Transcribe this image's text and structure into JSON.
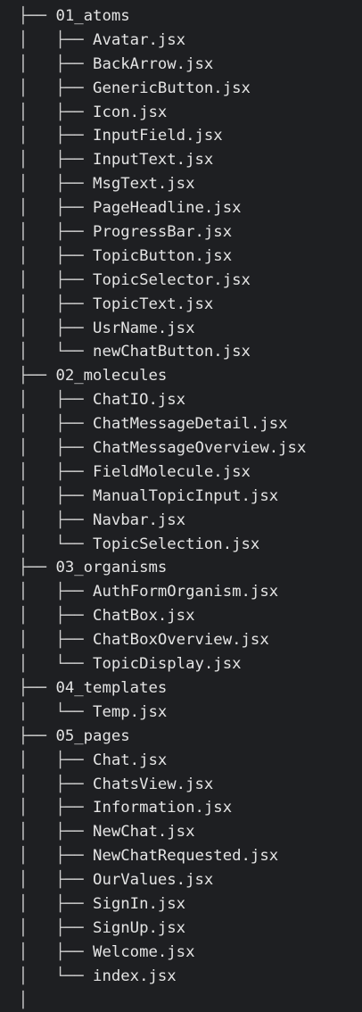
{
  "tree": {
    "rows": [
      {
        "prefix": "  ├── ",
        "name": "01_atoms",
        "type": "folder"
      },
      {
        "prefix": "  │   ├── ",
        "name": "Avatar.jsx",
        "type": "file"
      },
      {
        "prefix": "  │   ├── ",
        "name": "BackArrow.jsx",
        "type": "file"
      },
      {
        "prefix": "  │   ├── ",
        "name": "GenericButton.jsx",
        "type": "file"
      },
      {
        "prefix": "  │   ├── ",
        "name": "Icon.jsx",
        "type": "file"
      },
      {
        "prefix": "  │   ├── ",
        "name": "InputField.jsx",
        "type": "file"
      },
      {
        "prefix": "  │   ├── ",
        "name": "InputText.jsx",
        "type": "file"
      },
      {
        "prefix": "  │   ├── ",
        "name": "MsgText.jsx",
        "type": "file"
      },
      {
        "prefix": "  │   ├── ",
        "name": "PageHeadline.jsx",
        "type": "file"
      },
      {
        "prefix": "  │   ├── ",
        "name": "ProgressBar.jsx",
        "type": "file"
      },
      {
        "prefix": "  │   ├── ",
        "name": "TopicButton.jsx",
        "type": "file"
      },
      {
        "prefix": "  │   ├── ",
        "name": "TopicSelector.jsx",
        "type": "file"
      },
      {
        "prefix": "  │   ├── ",
        "name": "TopicText.jsx",
        "type": "file"
      },
      {
        "prefix": "  │   ├── ",
        "name": "UsrName.jsx",
        "type": "file"
      },
      {
        "prefix": "  │   └── ",
        "name": "newChatButton.jsx",
        "type": "file"
      },
      {
        "prefix": "  ├── ",
        "name": "02_molecules",
        "type": "folder"
      },
      {
        "prefix": "  │   ├── ",
        "name": "ChatIO.jsx",
        "type": "file"
      },
      {
        "prefix": "  │   ├── ",
        "name": "ChatMessageDetail.jsx",
        "type": "file"
      },
      {
        "prefix": "  │   ├── ",
        "name": "ChatMessageOverview.jsx",
        "type": "file"
      },
      {
        "prefix": "  │   ├── ",
        "name": "FieldMolecule.jsx",
        "type": "file"
      },
      {
        "prefix": "  │   ├── ",
        "name": "ManualTopicInput.jsx",
        "type": "file"
      },
      {
        "prefix": "  │   ├── ",
        "name": "Navbar.jsx",
        "type": "file"
      },
      {
        "prefix": "  │   └── ",
        "name": "TopicSelection.jsx",
        "type": "file"
      },
      {
        "prefix": "  ├── ",
        "name": "03_organisms",
        "type": "folder"
      },
      {
        "prefix": "  │   ├── ",
        "name": "AuthFormOrganism.jsx",
        "type": "file"
      },
      {
        "prefix": "  │   ├── ",
        "name": "ChatBox.jsx",
        "type": "file"
      },
      {
        "prefix": "  │   ├── ",
        "name": "ChatBoxOverview.jsx",
        "type": "file"
      },
      {
        "prefix": "  │   └── ",
        "name": "TopicDisplay.jsx",
        "type": "file"
      },
      {
        "prefix": "  ├── ",
        "name": "04_templates",
        "type": "folder"
      },
      {
        "prefix": "  │   └── ",
        "name": "Temp.jsx",
        "type": "file"
      },
      {
        "prefix": "  ├── ",
        "name": "05_pages",
        "type": "folder"
      },
      {
        "prefix": "  │   ├── ",
        "name": "Chat.jsx",
        "type": "file"
      },
      {
        "prefix": "  │   ├── ",
        "name": "ChatsView.jsx",
        "type": "file"
      },
      {
        "prefix": "  │   ├── ",
        "name": "Information.jsx",
        "type": "file"
      },
      {
        "prefix": "  │   ├── ",
        "name": "NewChat.jsx",
        "type": "file"
      },
      {
        "prefix": "  │   ├── ",
        "name": "NewChatRequested.jsx",
        "type": "file"
      },
      {
        "prefix": "  │   ├── ",
        "name": "OurValues.jsx",
        "type": "file"
      },
      {
        "prefix": "  │   ├── ",
        "name": "SignIn.jsx",
        "type": "file"
      },
      {
        "prefix": "  │   ├── ",
        "name": "SignUp.jsx",
        "type": "file"
      },
      {
        "prefix": "  │   ├── ",
        "name": "Welcome.jsx",
        "type": "file"
      },
      {
        "prefix": "  │   └── ",
        "name": "index.jsx",
        "type": "file"
      },
      {
        "prefix": "  │",
        "name": "",
        "type": "connector"
      }
    ]
  }
}
